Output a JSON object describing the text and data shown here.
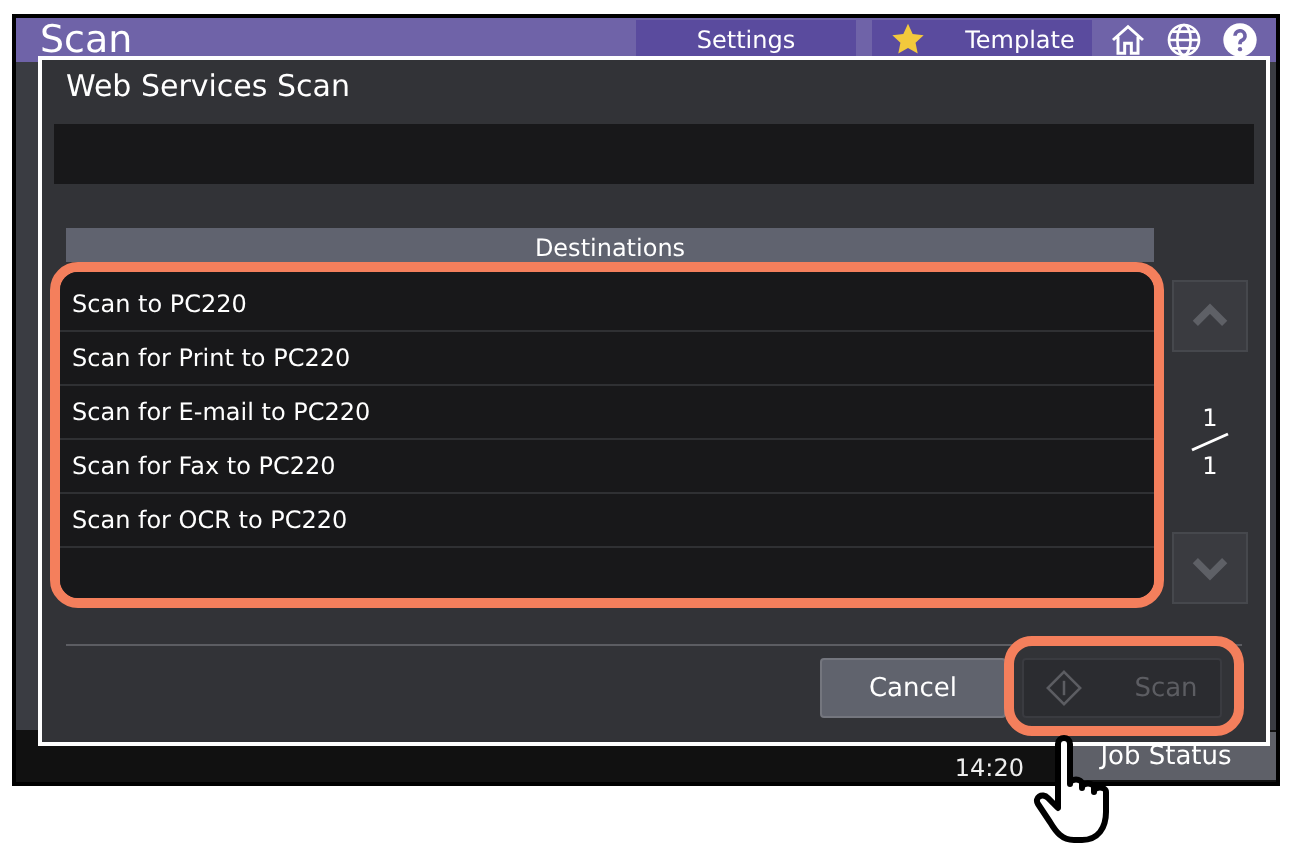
{
  "screen_title": "Scan",
  "top_bar": {
    "buttons": [
      {
        "label": "Settings",
        "kind": "plain"
      },
      {
        "label": "Template",
        "kind": "star"
      }
    ]
  },
  "dialog": {
    "title": "Web Services Scan",
    "list_header": "Destinations",
    "destinations": [
      {
        "label": "Scan to PC220",
        "selected": false
      },
      {
        "label": "Scan for Print to PC220",
        "selected": false
      },
      {
        "label": "Scan for E-mail to PC220",
        "selected": false
      },
      {
        "label": "Scan for Fax to PC220",
        "selected": false
      },
      {
        "label": "Scan for OCR to PC220",
        "selected": false
      }
    ],
    "pager": {
      "current": "1",
      "total": "1",
      "up_disabled": true,
      "down_disabled": true
    },
    "buttons": [
      {
        "label": "Cancel",
        "kind": "cancel",
        "disabled": false
      },
      {
        "label": "Scan",
        "kind": "start",
        "disabled": true
      }
    ]
  },
  "status_bar": {
    "time": "14:20",
    "job_status": "Job Status"
  }
}
